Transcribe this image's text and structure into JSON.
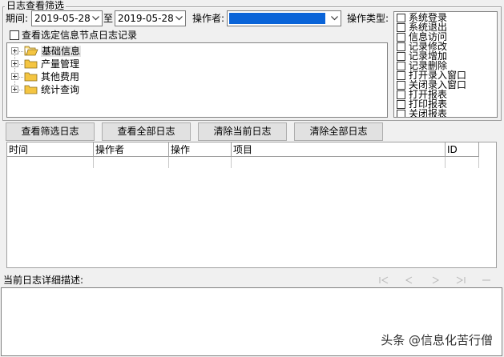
{
  "filter": {
    "group_title": "日志查看筛选",
    "period_label": "期间:",
    "date_from": "2019-05-28",
    "to_label": "至",
    "date_to": "2019-05-28",
    "operator_label": "操作者:",
    "operator_value": "",
    "optype_label": "操作类型:",
    "node_log_checkbox_label": "查看选定信息节点日志记录",
    "node_log_checked": false
  },
  "tree": {
    "items": [
      {
        "label": "基础信息",
        "icon": "folder-open-icon"
      },
      {
        "label": "产量管理",
        "icon": "folder-icon"
      },
      {
        "label": "其他费用",
        "icon": "folder-icon"
      },
      {
        "label": "统计查询",
        "icon": "folder-icon"
      }
    ]
  },
  "op_types": [
    {
      "label": "系统登录",
      "checked": false
    },
    {
      "label": "系统退出",
      "checked": false
    },
    {
      "label": "信息访问",
      "checked": false
    },
    {
      "label": "记录修改",
      "checked": false
    },
    {
      "label": "记录增加",
      "checked": false
    },
    {
      "label": "记录删除",
      "checked": false
    },
    {
      "label": "打开录入窗口",
      "checked": false
    },
    {
      "label": "关闭录入窗口",
      "checked": false
    },
    {
      "label": "打开报表",
      "checked": false
    },
    {
      "label": "打印报表",
      "checked": false
    },
    {
      "label": "关闭报表",
      "checked": false
    }
  ],
  "buttons": {
    "view_filtered": "查看筛选日志",
    "view_all": "查看全部日志",
    "clear_current": "清除当前日志",
    "clear_all": "清除全部日志"
  },
  "grid": {
    "columns": [
      "时间",
      "操作者",
      "操作",
      "项目",
      "ID"
    ]
  },
  "detail": {
    "label": "当前日志详细描述:"
  },
  "watermark": "头条 @信息化苦行僧",
  "colors": {
    "window_bg": "#f0f0f0",
    "selection_blue": "#0a64d8",
    "folder_yellow": "#f4c542"
  }
}
